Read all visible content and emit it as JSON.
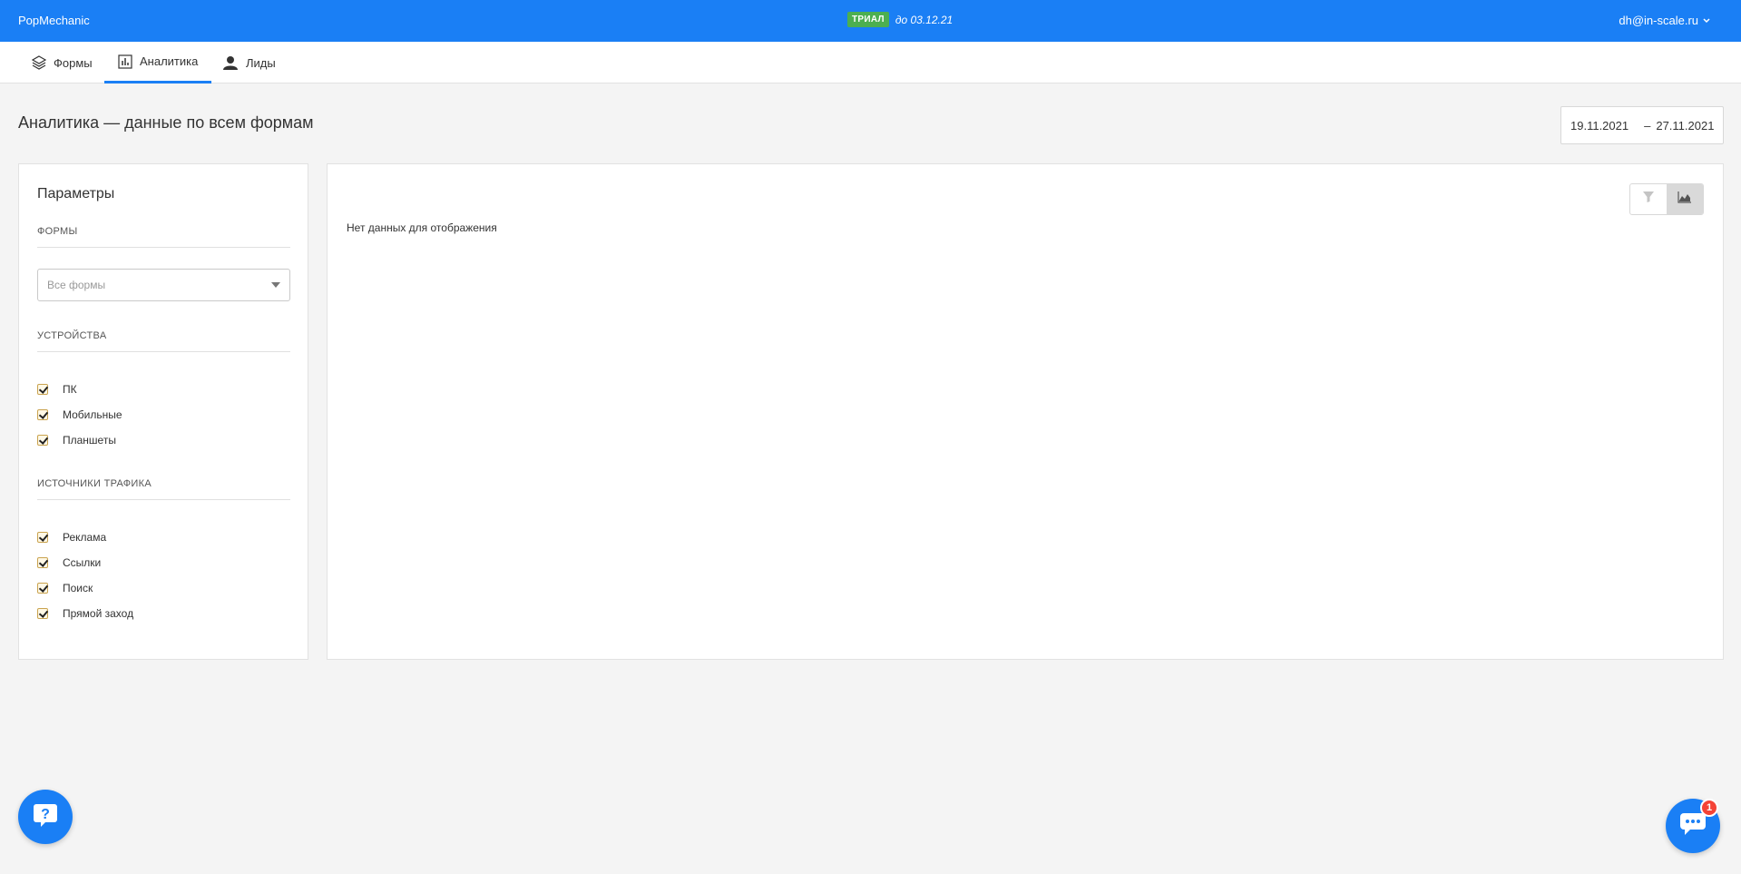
{
  "header": {
    "brand": "PopMechanic",
    "trial_badge": "ТРИАЛ",
    "trial_text": "до 03.12.21",
    "user_email": "dh@in-scale.ru"
  },
  "tabs": [
    {
      "label": "Формы",
      "icon": "layers-icon",
      "active": false
    },
    {
      "label": "Аналитика",
      "icon": "chart-icon",
      "active": true
    },
    {
      "label": "Лиды",
      "icon": "user-icon",
      "active": false
    }
  ],
  "page": {
    "title": "Аналитика — данные по всем формам",
    "date_from": "19.11.2021",
    "date_sep": "–",
    "date_to": "27.11.2021"
  },
  "params": {
    "title": "Параметры",
    "forms_heading": "Формы",
    "forms_select_placeholder": "Все формы",
    "devices_heading": "Устройства",
    "devices": [
      {
        "label": "ПК",
        "checked": true
      },
      {
        "label": "Мобильные",
        "checked": true
      },
      {
        "label": "Планшеты",
        "checked": true
      }
    ],
    "traffic_heading": "Источники трафика",
    "traffic": [
      {
        "label": "Реклама",
        "checked": true
      },
      {
        "label": "Ссылки",
        "checked": true
      },
      {
        "label": "Поиск",
        "checked": true
      },
      {
        "label": "Прямой заход",
        "checked": true
      }
    ]
  },
  "main": {
    "no_data": "Нет данных для отображения",
    "view_buttons": [
      {
        "icon": "filter-icon",
        "active": false
      },
      {
        "icon": "area-chart-icon",
        "active": true
      }
    ]
  },
  "widgets": {
    "chat_unread": "1"
  },
  "colors": {
    "accent": "#1a7ff5",
    "trial_badge": "#4caf50",
    "notification": "#f44336"
  }
}
